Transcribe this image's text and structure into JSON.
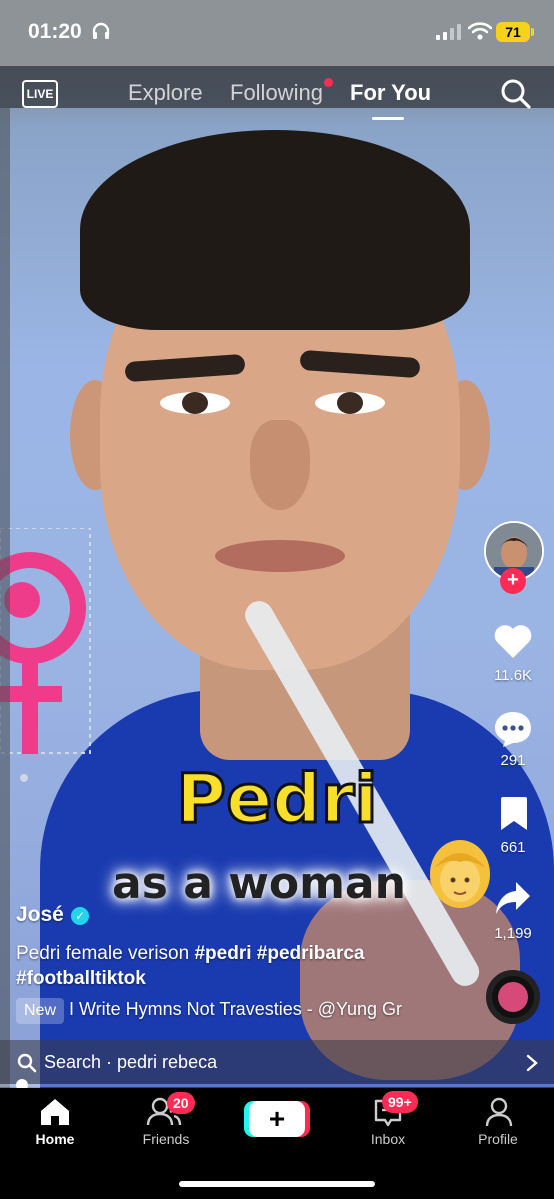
{
  "status_bar": {
    "time": "01:20",
    "battery": "71"
  },
  "top_nav": {
    "live_label": "LIVE",
    "tabs": [
      {
        "label": "Explore"
      },
      {
        "label": "Following"
      },
      {
        "label": "For You"
      }
    ],
    "active_tab": "For You"
  },
  "video": {
    "caption_line1": "Pedri",
    "caption_line2": "as a woman",
    "caption_emoji": "👱‍♀️"
  },
  "right_rail": {
    "likes": "11.6K",
    "comments": "291",
    "bookmarks": "661",
    "shares": "1,199"
  },
  "post": {
    "username": "José",
    "description_text": "Pedri female verison ",
    "hashtags": [
      "#pedri",
      "#pedribarca",
      "#footballtiktok"
    ],
    "new_badge": "New",
    "music": "I Write Hymns Not Travesties - @Yung Gr"
  },
  "search_bar": {
    "text": "Search · pedri rebeca"
  },
  "bottom_nav": {
    "items": [
      {
        "label": "Home"
      },
      {
        "label": "Friends",
        "badge": "20"
      },
      {
        "label": ""
      },
      {
        "label": "Inbox",
        "badge": "99+"
      },
      {
        "label": "Profile"
      }
    ]
  },
  "colors": {
    "accent": "#fe2c55",
    "cyan": "#25f4ee",
    "battery": "#f6d21a",
    "shirt": "#1a3bb0"
  },
  "icons": [
    "headphones-icon",
    "signal-icon",
    "wifi-icon",
    "battery-icon",
    "live-icon",
    "search-icon",
    "heart-icon",
    "comment-icon",
    "bookmark-icon",
    "share-icon",
    "home-icon",
    "friends-icon",
    "plus-icon",
    "inbox-icon",
    "profile-icon",
    "chevron-right-icon"
  ]
}
